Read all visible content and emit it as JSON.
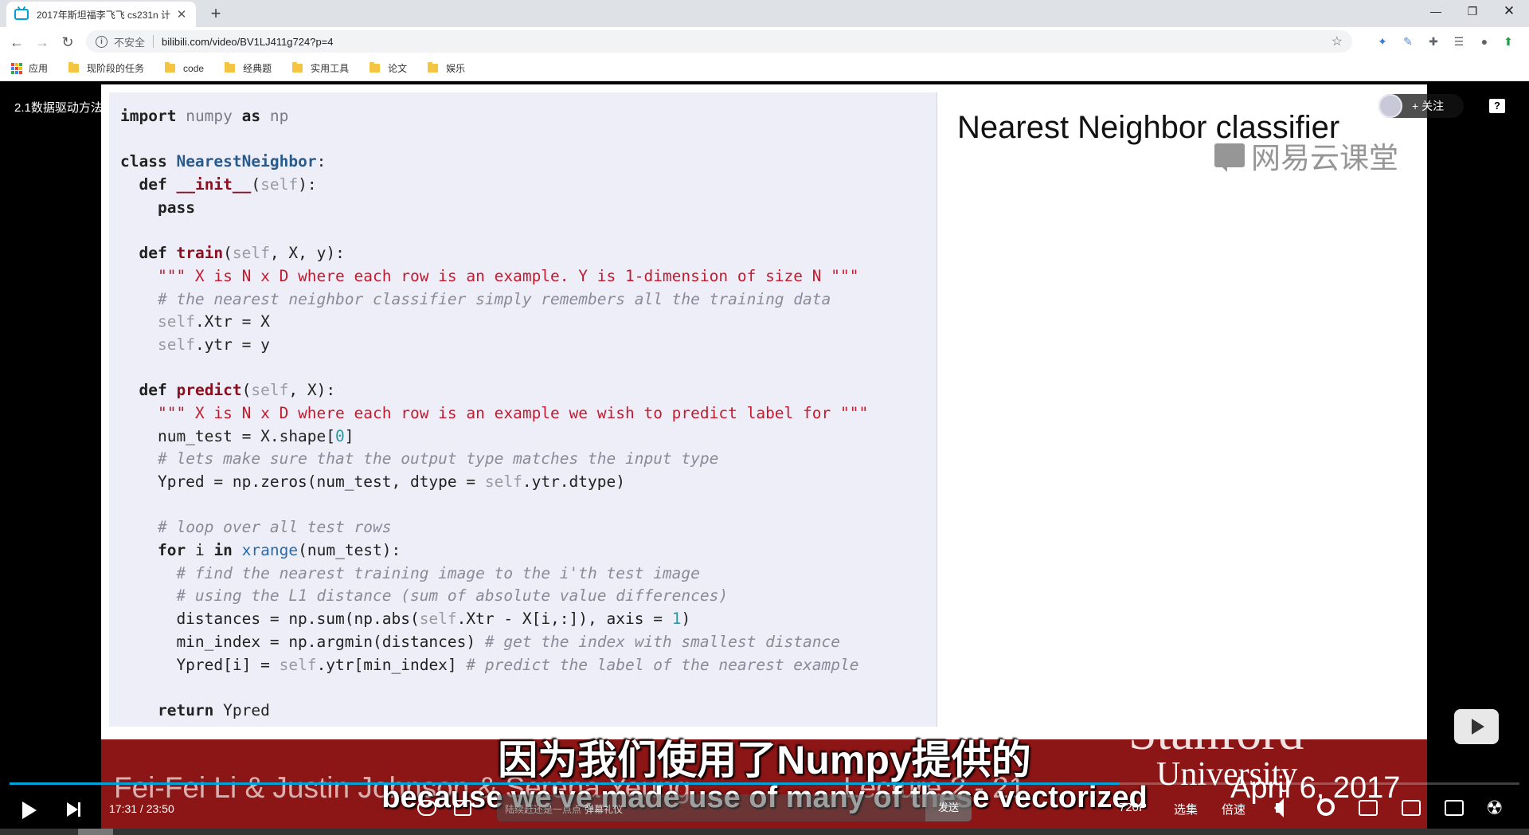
{
  "browser": {
    "tab_title": "2017年斯坦福李飞飞 cs231n 计",
    "new_tab": "+",
    "insecure_label": "不安全",
    "url": "bilibili.com/video/BV1LJ411g724?p=4",
    "bookmarks": [
      "应用",
      "现阶段的任务",
      "code",
      "经典题",
      "实用工具",
      "论文",
      "娱乐"
    ]
  },
  "player": {
    "video_title": "2.1数据驱动方法",
    "follow_label": "+ 关注",
    "subtitle_cn": "因为我们使用了Numpy提供的",
    "subtitle_en": "because we've made use of many of these vectorized",
    "current_time": "17:31",
    "total_time": "23:50",
    "progress": 0.735,
    "danmaku_placeholder": "陆续赶还是一点点",
    "danmaku_etiquette": "弹幕礼仪",
    "send_label": "发送",
    "quality": "720P",
    "episodes": "选集",
    "speed": "倍速"
  },
  "slide": {
    "title": "Nearest Neighbor classifier",
    "watermark": "网易云课堂",
    "footer_authors": "Fei-Fei Li & Justin Johnson & Serena Yeung",
    "footer_lecture": "Lecture 2 - 21",
    "footer_date": "April 6, 2017",
    "stanford": "Stanford",
    "university": "University",
    "code_lines": [
      "import numpy as np",
      "",
      "class NearestNeighbor:",
      "  def __init__(self):",
      "    pass",
      "",
      "  def train(self, X, y):",
      "    \"\"\" X is N x D where each row is an example. Y is 1-dimension of size N \"\"\"",
      "    # the nearest neighbor classifier simply remembers all the training data",
      "    self.Xtr = X",
      "    self.ytr = y",
      "",
      "  def predict(self, X):",
      "    \"\"\" X is N x D where each row is an example we wish to predict label for \"\"\"",
      "    num_test = X.shape[0]",
      "    # lets make sure that the output type matches the input type",
      "    Ypred = np.zeros(num_test, dtype = self.ytr.dtype)",
      "",
      "    # loop over all test rows",
      "    for i in xrange(num_test):",
      "      # find the nearest training image to the i'th test image",
      "      # using the L1 distance (sum of absolute value differences)",
      "      distances = np.sum(np.abs(self.Xtr - X[i,:]), axis = 1)",
      "      min_index = np.argmin(distances) # get the index with smallest distance",
      "      Ypred[i] = self.ytr[min_index] # predict the label of the nearest example",
      "",
      "    return Ypred"
    ]
  },
  "colors": {
    "bilibili_blue": "#00a1d6",
    "stanford_red": "#8c1515"
  }
}
